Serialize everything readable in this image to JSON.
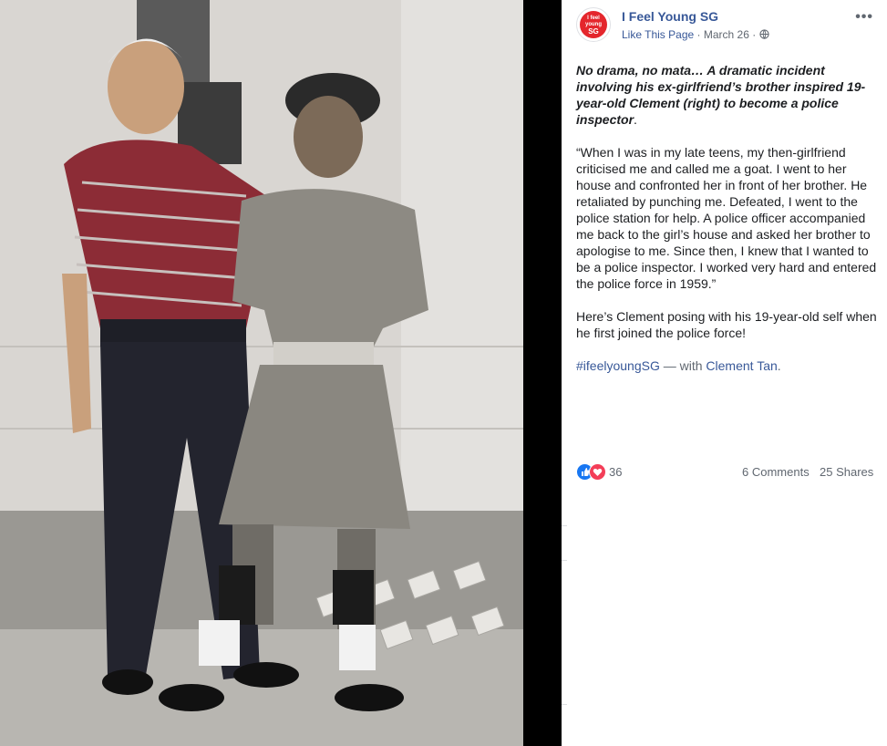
{
  "photo": {
    "description_icon": "photo-image"
  },
  "post": {
    "page_name": "I Feel Young SG",
    "avatar_text": [
      "I feel",
      "young",
      "SG"
    ],
    "like_page": "Like This Page",
    "date": "March 26",
    "separator": " · ",
    "more_label": "•••",
    "intro_bold": "No drama, no mata… A dramatic incident involving his ex-girlfriend’s brother inspired 19-year-old Clement (right) to become a police inspector",
    "intro_end": ".",
    "quote": "“When I was in my late teens, my then-girlfriend criticised me and called me a goat. I went to her house and confronted her in front of her brother. He retaliated by punching me. Defeated, I went to the police station for help. A police officer accompanied me back to the girl’s house and asked her brother to apologise to me. Since then, I knew that I wanted to be a police inspector. I worked very hard and entered the police force in 1959.”",
    "caption": "Here’s Clement posing with his 19-year-old self when he first joined the police force!",
    "hashtag": "#ifeelyoungSG",
    "with_text": " — with ",
    "tagged_person": "Clement Tan",
    "tag_end": "."
  },
  "engagement": {
    "reaction_count": "36",
    "comments": "6 Comments",
    "shares": "25 Shares"
  },
  "colors": {
    "link": "#385898",
    "brand_red": "#e4262c",
    "like_blue": "#1877f2",
    "love_red": "#f33e58"
  }
}
